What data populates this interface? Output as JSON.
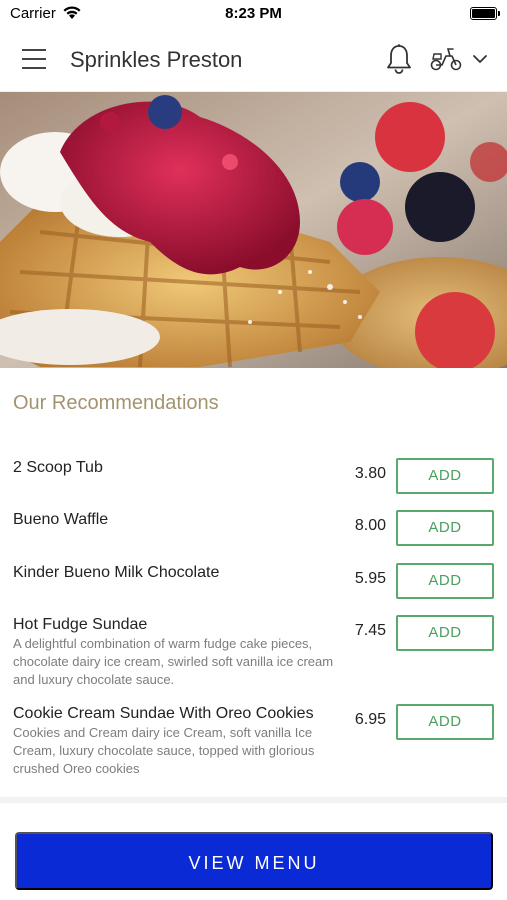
{
  "status_bar": {
    "carrier": "Carrier",
    "time": "8:23 PM"
  },
  "header": {
    "title": "Sprinkles Preston",
    "icons": [
      "menu-icon",
      "bell-icon",
      "scooter-icon",
      "chevron-down-icon"
    ]
  },
  "hero": {
    "icon": "waffle-photo"
  },
  "recommendations": {
    "title": "Our Recommendations",
    "add_label": "ADD",
    "items": [
      {
        "name": "2 Scoop Tub",
        "price": "3.80",
        "description": ""
      },
      {
        "name": "Bueno Waffle",
        "price": "8.00",
        "description": ""
      },
      {
        "name": "Kinder Bueno Milk Chocolate",
        "price": "5.95",
        "description": ""
      },
      {
        "name": "Hot Fudge Sundae",
        "price": "7.45",
        "description": "A delightful combination of warm fudge cake pieces, chocolate dairy ice cream, swirled soft vanilla ice cream and luxury chocolate sauce."
      },
      {
        "name": "Cookie Cream Sundae With Oreo Cookies",
        "price": "6.95",
        "description": "Cookies and Cream dairy ice Cream, soft vanilla Ice Cream, luxury chocolate sauce, topped with glorious crushed Oreo cookies"
      }
    ]
  },
  "footer": {
    "view_menu_label": "VIEW MENU"
  },
  "colors": {
    "accent_title": "#a39370",
    "add_button": "#5aa86b",
    "primary_button": "#0a2ad6"
  }
}
